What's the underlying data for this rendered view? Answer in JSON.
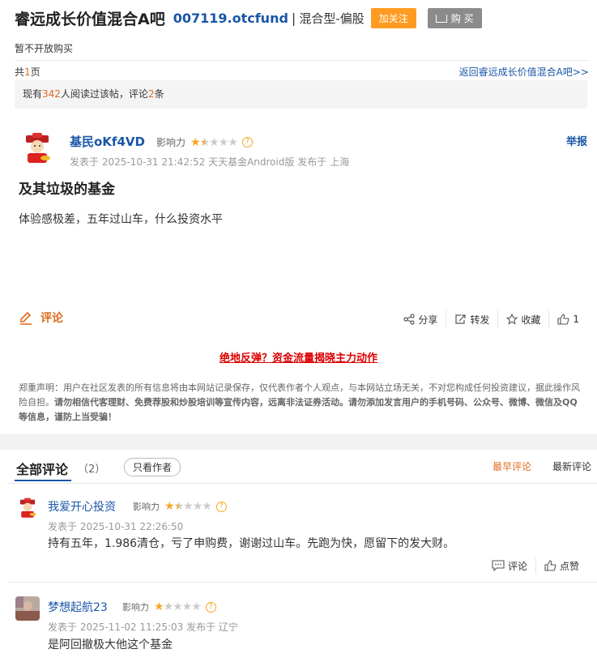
{
  "header": {
    "bar_name": "睿远成长价值混合A吧",
    "fund_code": "007119.otcfund",
    "separator": "|",
    "fund_type": "混合型-偏股",
    "follow_label": "加关注",
    "buy_label": "购 买"
  },
  "purchase_status": "暂不开放购买",
  "pagination": {
    "prefix": "共",
    "count": "1",
    "suffix": "页"
  },
  "back_link": "返回睿远成长价值混合A吧>>",
  "stats": {
    "pre": "现有",
    "reads": "342",
    "mid": "人阅读过该帖，评论",
    "comments": "2",
    "post": "条"
  },
  "post": {
    "author": "基民oKf4VD",
    "influence_label": "影响力",
    "influence_stars": 1.5,
    "report_label": "举报",
    "meta": "发表于 2025-10-31 21:42:52 天天基金Android版 发布于 上海",
    "title": "及其垃圾的基金",
    "body": "体验感极差，五年过山车，什么投资水平",
    "comment_label": "评论",
    "share_label": "分享",
    "forward_label": "转发",
    "collect_label": "收藏",
    "like_count": "1"
  },
  "promo_link": "绝地反弹？资金流量揭晓主力动作",
  "disclaimer": {
    "normal": "郑重声明：用户在社区发表的所有信息将由本网站记录保存，仅代表作者个人观点，与本网站立场无关，不对您构成任何投资建议，据此操作风险自担。",
    "bold": "请勿相信代客理财、免费荐股和炒股培训等宣传内容，远离非法证券活动。请勿添加发言用户的手机号码、公众号、微博、微信及QQ等信息，谨防上当受骗！"
  },
  "comments_section": {
    "title": "全部评论",
    "count": "（2）",
    "only_author_label": "只看作者",
    "sort_earliest": "最早评论",
    "sort_newest": "最新评论"
  },
  "comments": [
    {
      "author": "我爱开心投资",
      "influence_label": "影响力",
      "influence_stars": 1.5,
      "meta": "发表于 2025-10-31 22:26:50",
      "body": "持有五年，1.986清仓，亏了申购费，谢谢过山车。先跑为快，愿留下的发大财。",
      "reply_label": "评论",
      "like_label": "点赞"
    },
    {
      "author": "梦想起航23",
      "influence_label": "影响力",
      "influence_stars": 1,
      "meta": "发表于 2025-11-02 11:25:03 发布于 辽宁",
      "body": "是阿回撤极大他这个基金"
    }
  ],
  "colors": {
    "link_blue": "#1a56a8",
    "accent_orange": "#e06c1e",
    "follow_orange": "#ff9b21",
    "promo_red": "#dd0000",
    "star_gold": "#f5a623"
  }
}
